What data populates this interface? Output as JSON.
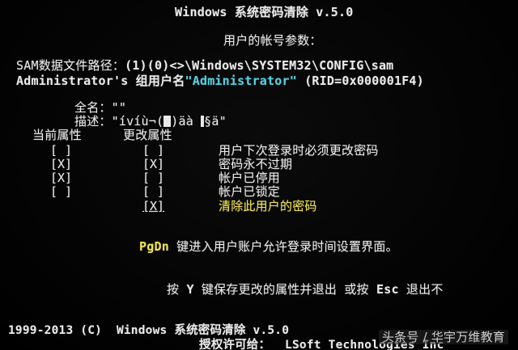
{
  "title": "Windows 系统密码清除 v.5.0",
  "subtitle": "用户的帐号参数：",
  "sam_path": {
    "label": "SAM数据文件路径：",
    "value": "(1)(0)<>\\Windows\\SYSTEM32\\CONFIG\\sam"
  },
  "account": {
    "prefix": "Administrator's 组用户名",
    "username": "\"Administrator\"",
    "rid": "(RID=0x000001F4)"
  },
  "fullname": {
    "label": "全名：",
    "value": "\"\""
  },
  "description": {
    "label": "描述：",
    "value": "\"ívíù¬(",
    "value2": ")äà ",
    "value3": "§ä\""
  },
  "columns": {
    "current": "当前属性",
    "change": "更改属性"
  },
  "attributes": [
    {
      "current": "[ ]",
      "change": "[ ]",
      "label": "用户下次登录时必须更改密码"
    },
    {
      "current": "[X]",
      "change": "[X]",
      "label": "密码永不过期"
    },
    {
      "current": "[X]",
      "change": "[ ]",
      "label": "帐户已停用"
    },
    {
      "current": "[ ]",
      "change": "[ ]",
      "label": "帐户已锁定"
    },
    {
      "current": "",
      "change": "[X]",
      "label": "清除此用户的密码",
      "highlight": true
    }
  ],
  "pgdn_hint": {
    "key": "PgDn",
    "text": "键进入用户账户允许登录时间设置界面。"
  },
  "bottom_hint": {
    "text1": "按",
    "key1": "Y",
    "text2": "键保存更改的属性并退出 或按",
    "key2": "Esc",
    "text3": "退出不"
  },
  "footer": {
    "copyright": "1999-2013 (C)  Windows 系统密码清除 v.5.0",
    "license": "授权许可给：  LSoft Technologies Inc"
  },
  "watermark": "头条号 / 华宇万维教育",
  "colors": {
    "background": "#050505",
    "text": "#e9e9e9",
    "username": "#4fd0e3",
    "highlight": "#f2e34a"
  }
}
